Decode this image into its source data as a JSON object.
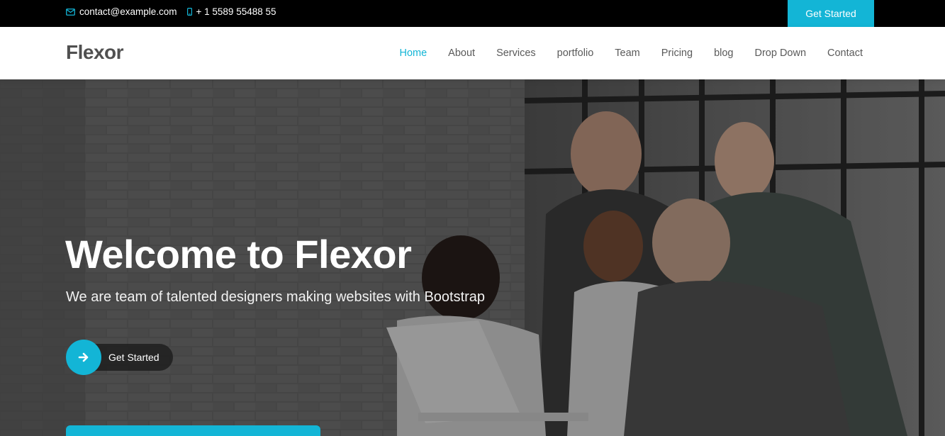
{
  "topbar": {
    "email": "contact@example.com",
    "phone": "+ 1 5589 55488 55",
    "cta_label": "Get Started"
  },
  "header": {
    "logo": "Flexor",
    "nav": [
      {
        "label": "Home",
        "active": true
      },
      {
        "label": "About"
      },
      {
        "label": "Services"
      },
      {
        "label": "portfolio"
      },
      {
        "label": "Team"
      },
      {
        "label": "Pricing"
      },
      {
        "label": "blog"
      },
      {
        "label": "Drop Down"
      },
      {
        "label": "Contact"
      }
    ]
  },
  "hero": {
    "title": "Welcome to Flexor",
    "subtitle": "We are team of talented designers making websites with Bootstrap",
    "button_label": "Get Started"
  },
  "colors": {
    "accent": "#13b5d6",
    "topbar_bg": "#000000"
  },
  "icons": {
    "email": "envelope-icon",
    "phone": "phone-icon",
    "button": "arrow-right-icon"
  }
}
